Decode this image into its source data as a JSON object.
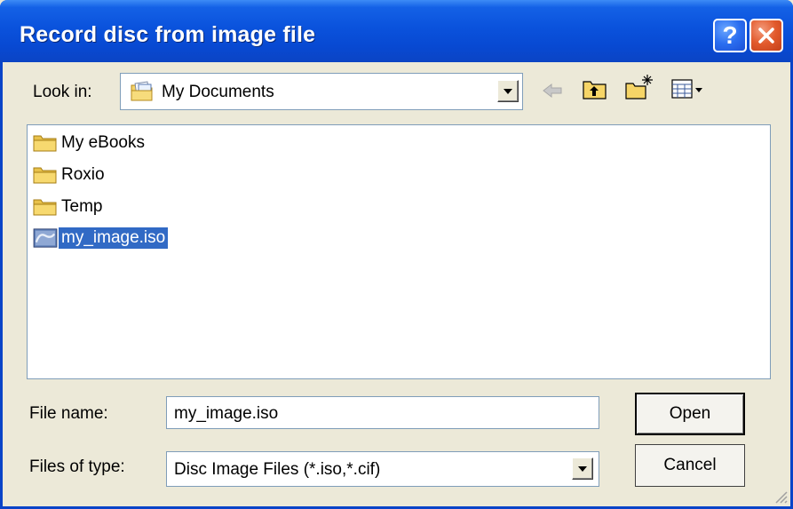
{
  "window": {
    "title": "Record disc from image file",
    "help_glyph": "?"
  },
  "look_in": {
    "label": "Look in:",
    "value": "My Documents",
    "icon": "my-documents-folder-icon"
  },
  "toolbar": {
    "icons": [
      "back-arrow-icon",
      "up-one-level-icon",
      "create-new-folder-icon",
      "view-menu-icon"
    ]
  },
  "files": [
    {
      "name": "My eBooks",
      "type": "folder",
      "selected": false
    },
    {
      "name": "Roxio",
      "type": "folder",
      "selected": false
    },
    {
      "name": "Temp",
      "type": "folder",
      "selected": false
    },
    {
      "name": "my_image.iso",
      "type": "disc-image",
      "selected": true
    }
  ],
  "file_name": {
    "label": "File name:",
    "value": "my_image.iso"
  },
  "file_type": {
    "label": "Files of type:",
    "value": "Disc Image Files (*.iso,*.cif)"
  },
  "buttons": {
    "open": "Open",
    "cancel": "Cancel"
  },
  "colors": {
    "titlebar": "#0a52dc",
    "selection": "#316ac5",
    "face": "#ece9d8"
  }
}
